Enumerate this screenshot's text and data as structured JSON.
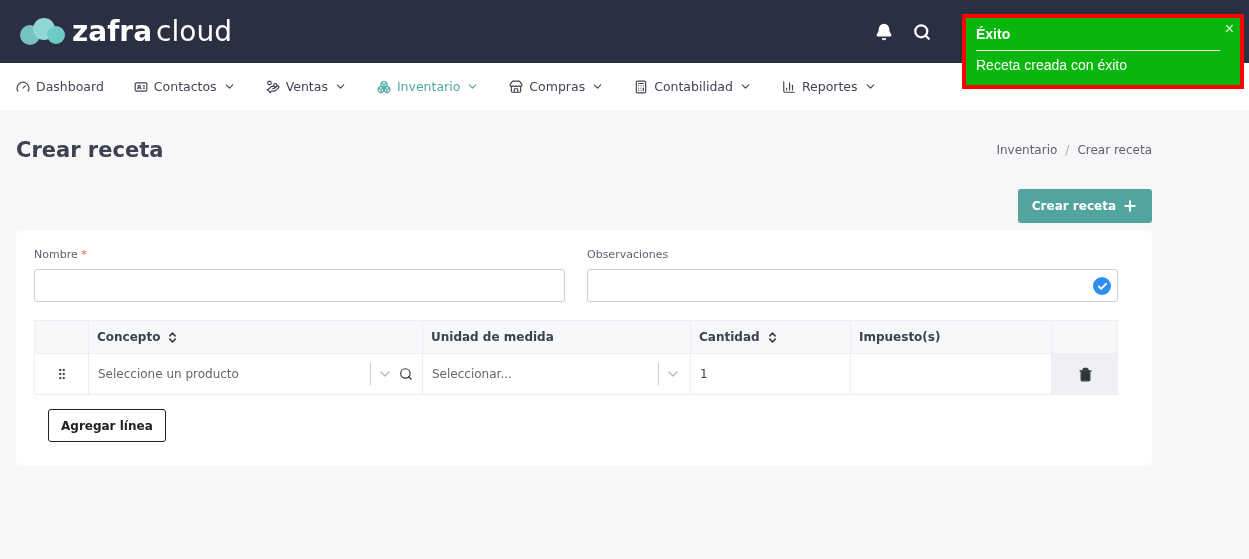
{
  "logo": {
    "part_1": "zafra",
    "part_2": "cloud"
  },
  "nav": [
    {
      "label": "Dashboard",
      "dropdown": false,
      "selected": false
    },
    {
      "label": "Contactos",
      "dropdown": true,
      "selected": false
    },
    {
      "label": "Ventas",
      "dropdown": true,
      "selected": false
    },
    {
      "label": "Inventario",
      "dropdown": true,
      "selected": true
    },
    {
      "label": "Compras",
      "dropdown": true,
      "selected": false
    },
    {
      "label": "Contabilidad",
      "dropdown": true,
      "selected": false
    },
    {
      "label": "Reportes",
      "dropdown": true,
      "selected": false
    }
  ],
  "toast": {
    "title": "Éxito",
    "message": "Receta creada con éxito",
    "close": "×"
  },
  "page_title": "Crear receta",
  "breadcrumb": [
    "Inventario",
    "Crear receta"
  ],
  "breadcrumb_separator": "/",
  "create_button": "Crear receta",
  "form": {
    "name_label": "Nombre",
    "name_required": true,
    "required_mark": "*",
    "notes_label": "Observaciones",
    "notes_verified": true
  },
  "table": {
    "columns": [
      {
        "label": "Concepto",
        "sortable": true
      },
      {
        "label": "Unidad de medida",
        "sortable": false
      },
      {
        "label": "Cantidad",
        "sortable": true
      },
      {
        "label": "Impuesto(s)",
        "sortable": false
      }
    ],
    "rows": [
      {
        "product_placeholder": "Seleccione un producto",
        "unit_placeholder": "Seleccionar...",
        "quantity": "1"
      }
    ]
  },
  "add_line_button": "Agregar línea"
}
